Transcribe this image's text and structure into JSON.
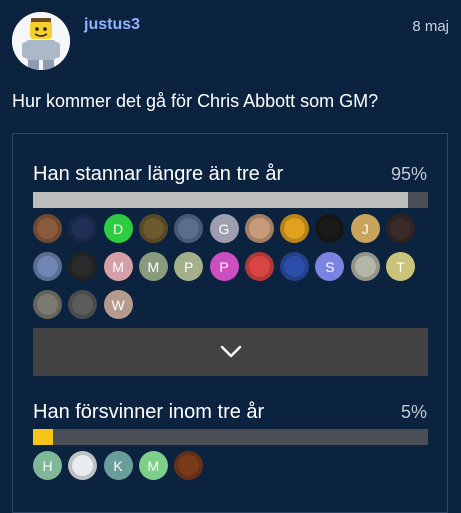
{
  "post": {
    "username": "justus3",
    "date": "8 maj",
    "question": "Hur kommer det gå för Chris Abbott som GM?"
  },
  "poll": {
    "options": [
      {
        "label": "Han stannar längre än tre år",
        "percent_label": "95%",
        "percent": 95,
        "bar_color": "#bdbdbd",
        "voters": [
          {
            "letter": "",
            "color": "#8a5a3c"
          },
          {
            "letter": "",
            "color": "#1f2f55"
          },
          {
            "letter": "D",
            "color": "#2ecc40"
          },
          {
            "letter": "",
            "color": "#6b5a2e"
          },
          {
            "letter": "",
            "color": "#5a6f8a"
          },
          {
            "letter": "G",
            "color": "#9e9eaf"
          },
          {
            "letter": "",
            "color": "#c99a7a"
          },
          {
            "letter": "",
            "color": "#e0a020"
          },
          {
            "letter": "",
            "color": "#1a1a1a"
          },
          {
            "letter": "J",
            "color": "#c9a45c"
          },
          {
            "letter": "",
            "color": "#3a2a2a"
          },
          {
            "letter": "",
            "color": "#6f86b3"
          },
          {
            "letter": "",
            "color": "#2a2a2a"
          },
          {
            "letter": "M",
            "color": "#d49fa6"
          },
          {
            "letter": "M",
            "color": "#8a9a7e"
          },
          {
            "letter": "P",
            "color": "#a3b08a"
          },
          {
            "letter": "P",
            "color": "#cc4fbf"
          },
          {
            "letter": "",
            "color": "#d94444"
          },
          {
            "letter": "",
            "color": "#2b4fa8"
          },
          {
            "letter": "S",
            "color": "#7a83e0"
          },
          {
            "letter": "",
            "color": "#b5b5a8"
          },
          {
            "letter": "T",
            "color": "#c9c47a"
          },
          {
            "letter": "",
            "color": "#7a7a70"
          },
          {
            "letter": "",
            "color": "#5c5c5c"
          },
          {
            "letter": "W",
            "color": "#b59a8e"
          }
        ]
      },
      {
        "label": "Han försvinner inom tre år",
        "percent_label": "5%",
        "percent": 5,
        "bar_color": "#f5c518",
        "voters": [
          {
            "letter": "H",
            "color": "#7fb896"
          },
          {
            "letter": "",
            "color": "#e8ecef"
          },
          {
            "letter": "K",
            "color": "#6b9e9a"
          },
          {
            "letter": "M",
            "color": "#7dcf8a"
          },
          {
            "letter": "",
            "color": "#7a3a1a"
          }
        ]
      }
    ],
    "expand_icon": "chevron-down-icon"
  }
}
